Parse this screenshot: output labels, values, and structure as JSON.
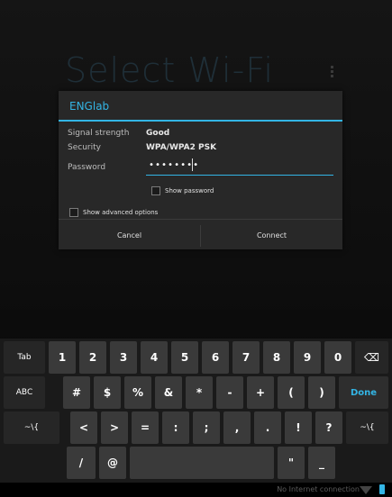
{
  "backdrop": {
    "title": "Select Wi-Fi"
  },
  "dialog": {
    "title": "ENGlab",
    "rows": {
      "signal_label": "Signal strength",
      "signal_value": "Good",
      "security_label": "Security",
      "security_value": "WPA/WPA2 PSK",
      "password_label": "Password"
    },
    "password_value": "••••••••",
    "show_password_label": "Show password",
    "show_advanced_label": "Show advanced options",
    "cancel_label": "Cancel",
    "connect_label": "Connect"
  },
  "keyboard": {
    "row1": [
      "Tab",
      "1",
      "2",
      "3",
      "4",
      "5",
      "6",
      "7",
      "8",
      "9",
      "0",
      "⌫"
    ],
    "row2": [
      "ABC",
      "#",
      "$",
      "%",
      "&",
      "*",
      "-",
      "+",
      "(",
      ")",
      "Done"
    ],
    "row3": [
      "~\\{",
      "<",
      ">",
      "=",
      ":",
      ";",
      ",",
      ".",
      "!",
      "?",
      "~\\{"
    ],
    "row4": [
      "/",
      "@",
      "",
      "\"",
      "_"
    ]
  },
  "status": {
    "text": "No Internet connection"
  },
  "colors": {
    "accent": "#33b5e5"
  }
}
